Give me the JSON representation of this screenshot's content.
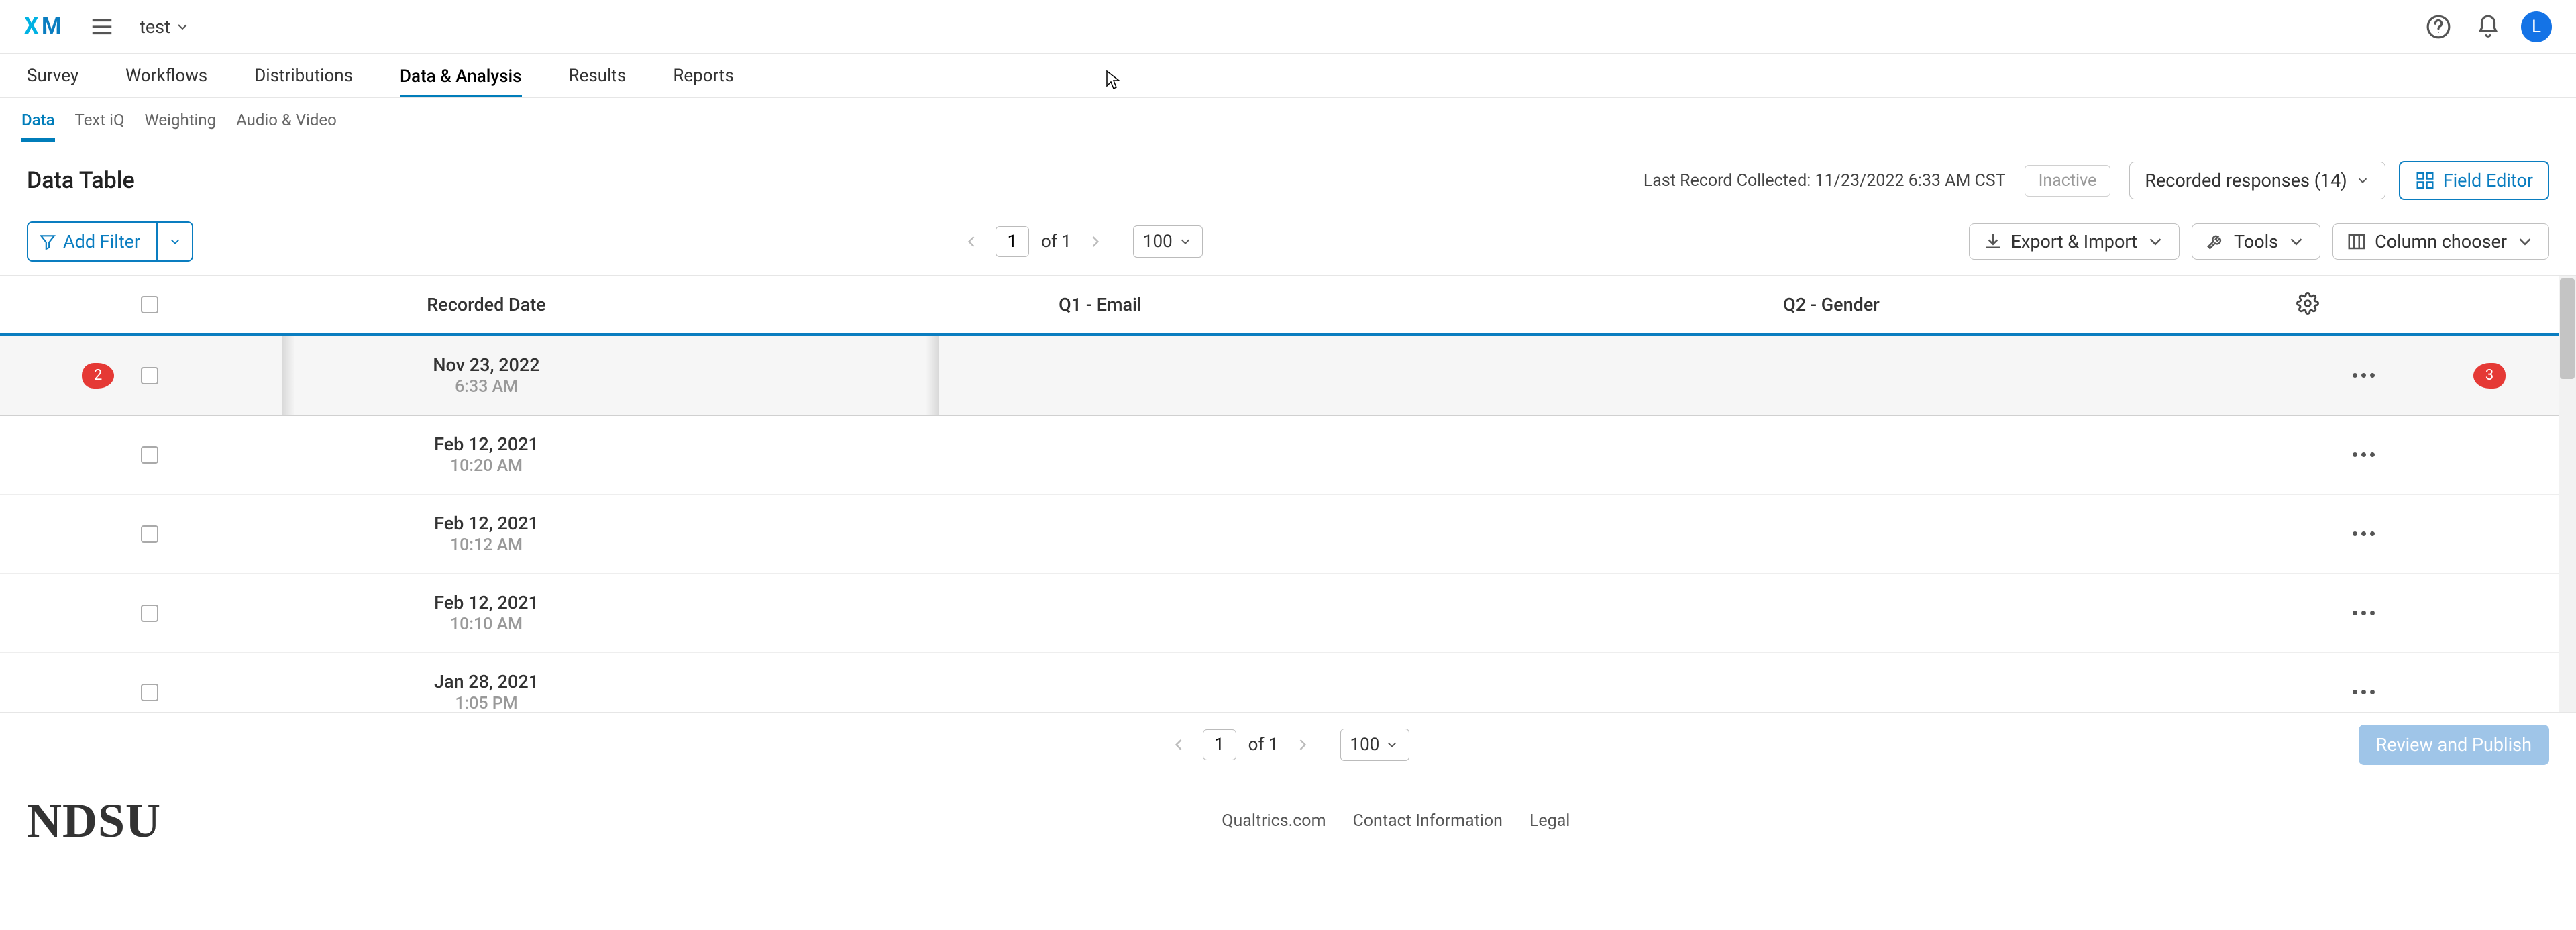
{
  "header": {
    "project_name": "test",
    "avatar_initial": "L"
  },
  "main_tabs": [
    {
      "label": "Survey"
    },
    {
      "label": "Workflows"
    },
    {
      "label": "Distributions"
    },
    {
      "label": "Data & Analysis",
      "active": true
    },
    {
      "label": "Results"
    },
    {
      "label": "Reports"
    }
  ],
  "sub_tabs": [
    {
      "label": "Data",
      "active": true
    },
    {
      "label": "Text iQ"
    },
    {
      "label": "Weighting"
    },
    {
      "label": "Audio & Video"
    }
  ],
  "page_title": "Data Table",
  "info": {
    "last_record": "Last Record Collected: 11/23/2022 6:33 AM CST",
    "inactive_label": "Inactive",
    "responses_label": "Recorded responses (14)",
    "field_editor_label": "Field Editor"
  },
  "toolbar": {
    "add_filter_label": "Add Filter",
    "of_label_top": "of 1",
    "page_value_top": "1",
    "page_size_top": "100",
    "of_label_bottom": "of 1",
    "page_value_bottom": "1",
    "page_size_bottom": "100",
    "export_import_label": "Export & Import",
    "tools_label": "Tools",
    "column_chooser_label": "Column chooser",
    "review_publish_label": "Review and Publish"
  },
  "columns": {
    "date": "Recorded Date",
    "q1": "Q1 - Email",
    "q2": "Q2 - Gender"
  },
  "rows": [
    {
      "date": "Nov 23, 2022",
      "time": "6:33 AM",
      "hovered": true
    },
    {
      "date": "Feb 12, 2021",
      "time": "10:20 AM"
    },
    {
      "date": "Feb 12, 2021",
      "time": "10:12 AM"
    },
    {
      "date": "Feb 12, 2021",
      "time": "10:10 AM"
    },
    {
      "date": "Jan 28, 2021",
      "time": "1:05 PM"
    }
  ],
  "callouts": {
    "left": "2",
    "right": "3"
  },
  "footer": {
    "brand": "NDSU",
    "links": [
      "Qualtrics.com",
      "Contact Information",
      "Legal"
    ]
  }
}
